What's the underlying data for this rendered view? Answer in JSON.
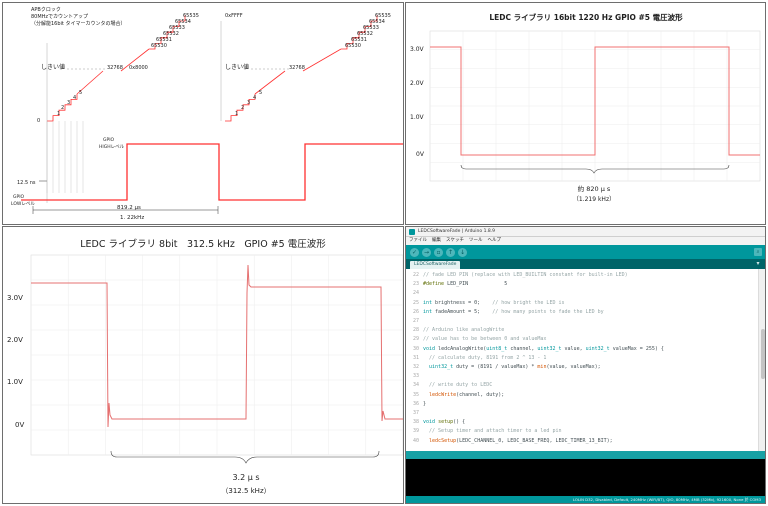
{
  "apb_panel": {
    "caption_lines": [
      "APBクロック",
      "80MHzでカウントアップ",
      "（分解能16bit タイマーカウンタの場合）"
    ],
    "counts_left": [
      "1",
      "2",
      "3",
      "4",
      "5"
    ],
    "counts_top": [
      "65530",
      "65531",
      "65532",
      "65533",
      "65534",
      "65535"
    ],
    "count_zero": "0",
    "threshold_label": "しきい値",
    "threshold_value": "32768",
    "threshold_hex": "0x8000",
    "max_hex": "0xFFFF",
    "gpio_high_label": [
      "GPIO",
      "HIGHレベル"
    ],
    "gpio_low_label": [
      "GPIO",
      "LOWレベル"
    ],
    "tick_label": "12.5 ns",
    "period_value": "819.2 μs",
    "frequency_value": "1. 22kHz",
    "line_color": "#ff3030"
  },
  "scope_16bit": {
    "title": "LEDC ライブラリ 16bit 1220 Hz GPIO #5 電圧波形",
    "y_ticks": [
      "3.0V",
      "2.0V",
      "1.0V",
      "0V"
    ],
    "period_value": "約 820 μ s",
    "frequency_value": "（1.219 kHz）",
    "trace_color": "#f07070"
  },
  "scope_8bit": {
    "title": "LEDC ライブラリ 8bit　312.5 kHz　GPIO #5 電圧波形",
    "y_ticks": [
      "3.0V",
      "2.0V",
      "1.0V",
      "0V"
    ],
    "period_value": "3.2 μ s",
    "frequency_value": "（312.5 kHz）",
    "trace_color": "#e57070"
  },
  "ide": {
    "window_title": "LEDCSoftwareFade | Arduino 1.8.9",
    "menu": [
      "ファイル",
      "編集",
      "スケッチ",
      "ツール",
      "ヘルプ"
    ],
    "toolbar": {
      "verify_icon": "check-icon",
      "upload_icon": "arrow-right-icon",
      "new_icon": "new-file-icon",
      "open_icon": "arrow-up-icon",
      "save_icon": "arrow-down-icon",
      "serial_icon": "magnifier-icon"
    },
    "tab_label": "LEDCSoftwareFade",
    "accent_color": "#00979c",
    "code_lines": [
      {
        "n": "22",
        "parts": [
          {
            "c": "cmt",
            "t": "// fade LED PIN (replace with LED_BUILTIN constant for built-in LED)"
          }
        ]
      },
      {
        "n": "23",
        "parts": [
          {
            "c": "kw-dir",
            "t": "#define"
          },
          {
            "c": "plain",
            "t": " LED_PIN            5"
          }
        ]
      },
      {
        "n": "24",
        "parts": []
      },
      {
        "n": "25",
        "parts": [
          {
            "c": "kw-type",
            "t": "int"
          },
          {
            "c": "plain",
            "t": " brightness = 0;    "
          },
          {
            "c": "cmt",
            "t": "// how bright the LED is"
          }
        ]
      },
      {
        "n": "26",
        "parts": [
          {
            "c": "kw-type",
            "t": "int"
          },
          {
            "c": "plain",
            "t": " fadeAmount = 5;    "
          },
          {
            "c": "cmt",
            "t": "// how many points to fade the LED by"
          }
        ]
      },
      {
        "n": "27",
        "parts": []
      },
      {
        "n": "28",
        "parts": [
          {
            "c": "cmt",
            "t": "// Arduino like analogWrite"
          }
        ]
      },
      {
        "n": "29",
        "parts": [
          {
            "c": "cmt",
            "t": "// value has to be between 0 and valueMax"
          }
        ]
      },
      {
        "n": "30",
        "parts": [
          {
            "c": "kw-type",
            "t": "void"
          },
          {
            "c": "plain",
            "t": " ledcAnalogWrite("
          },
          {
            "c": "kw-type",
            "t": "uint8_t"
          },
          {
            "c": "plain",
            "t": " channel, "
          },
          {
            "c": "kw-type",
            "t": "uint32_t"
          },
          {
            "c": "plain",
            "t": " value, "
          },
          {
            "c": "kw-type",
            "t": "uint32_t"
          },
          {
            "c": "plain",
            "t": " valueMax = 255) {"
          }
        ]
      },
      {
        "n": "31",
        "parts": [
          {
            "c": "cmt",
            "t": "  // calculate duty, 8191 from 2 ^ 13 - 1"
          }
        ]
      },
      {
        "n": "32",
        "parts": [
          {
            "c": "plain",
            "t": "  "
          },
          {
            "c": "kw-type",
            "t": "uint32_t"
          },
          {
            "c": "plain",
            "t": " duty = (8191 / valueMax) * "
          },
          {
            "c": "fn",
            "t": "min"
          },
          {
            "c": "plain",
            "t": "(value, valueMax);"
          }
        ]
      },
      {
        "n": "33",
        "parts": []
      },
      {
        "n": "34",
        "parts": [
          {
            "c": "cmt",
            "t": "  // write duty to LEDC"
          }
        ]
      },
      {
        "n": "35",
        "parts": [
          {
            "c": "plain",
            "t": "  "
          },
          {
            "c": "fn",
            "t": "ledcWrite"
          },
          {
            "c": "plain",
            "t": "(channel, duty);"
          }
        ]
      },
      {
        "n": "36",
        "parts": [
          {
            "c": "plain",
            "t": "}"
          }
        ]
      },
      {
        "n": "37",
        "parts": []
      },
      {
        "n": "38",
        "parts": [
          {
            "c": "kw-type",
            "t": "void"
          },
          {
            "c": "plain",
            "t": " "
          },
          {
            "c": "kw-dir",
            "t": "setup"
          },
          {
            "c": "plain",
            "t": "() {"
          }
        ]
      },
      {
        "n": "39",
        "parts": [
          {
            "c": "cmt",
            "t": "  // Setup timer and attach timer to a led pin"
          }
        ]
      },
      {
        "n": "40",
        "parts": [
          {
            "c": "plain",
            "t": "  "
          },
          {
            "c": "fn",
            "t": "ledcSetup"
          },
          {
            "c": "plain",
            "t": "(LEDC_CHANNEL_0, LEDC_BASE_FREQ, LEDC_TIMER_13_BIT);"
          }
        ]
      }
    ],
    "status_text": "",
    "bottom_bar": "LOLIN D32, Disabled, Default, 240MHz (WiFi/BT), QIO, 80MHz, 4MB (32Mb), 921600, None 於 COM3"
  }
}
